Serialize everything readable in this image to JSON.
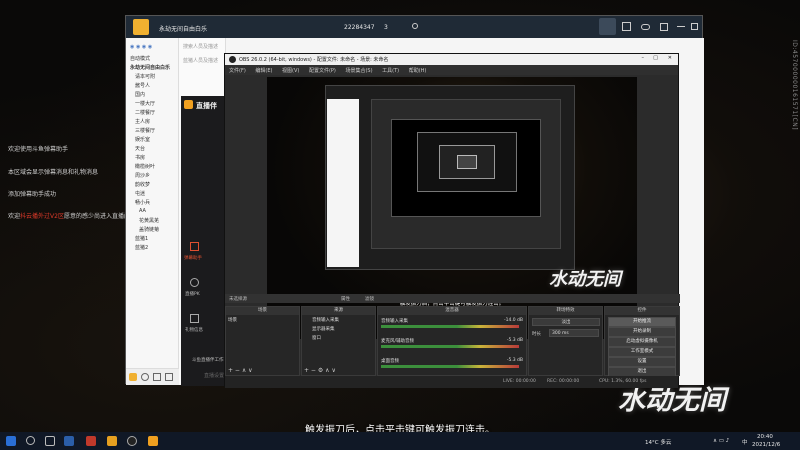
{
  "left_overlay": {
    "lines": [
      "欢迎使用斗鱼弹幕助手",
      "本区域会显示弹幕消息和礼物消息",
      "添加弹幕助手成功"
    ],
    "last_line_prefix": "欢迎",
    "last_line_highlight": "抖云播外过V2区",
    "last_line_suffix": "愿意的感少尚进入直播间"
  },
  "vertical_id": "ID:457000000161571[CN]",
  "watermark_logo": "水动无间",
  "main_subtitle": "触发振刀后，点击平击键可触发振刀连击。",
  "chat_window": {
    "title": "永劫无间自由白乐",
    "id_number": "22284347",
    "member_count": "3",
    "search_hint": "搜索人员及描述",
    "left_items": [
      "自动模式",
      "永劫无间自由白乐",
      "请本可附",
      "酱号人",
      "国内",
      "一楼大厅",
      "二楼餐厅",
      "主人房",
      "三楼餐厅",
      "娱乐室",
      "天台",
      "书房",
      "橄榄树叶",
      "周沙乡",
      "韵收梦",
      "屯迷",
      "畅小兵",
      "AA",
      "花黄黑羌",
      "盖骑链菊",
      "蓝猪1",
      "蓝猪2"
    ],
    "mid_items": [
      "蓝猪人员及描述"
    ],
    "douyu_logo": "直播伴",
    "douyu_menu": [
      "弹幕助手",
      "直播PK",
      "礼物信息"
    ],
    "douyu_footer": "斗鱼直播伴工作台",
    "bottom_label": "直播设置"
  },
  "obs": {
    "title": "OBS 26.0.2 (64-bit, windows) - 配置文件: 未命名 - 场景: 未命名",
    "menu": [
      "文件(F)",
      "编辑(E)",
      "视图(V)",
      "配置文件(P)",
      "场景集合(S)",
      "工具(T)",
      "帮助(H)"
    ],
    "preview_subtitle": "触发振刀后，点击平击键可触发振刀连击。",
    "source_bar_label": "未选择源",
    "source_bar_tabs": [
      "属性",
      "滤镜"
    ],
    "panels": {
      "scenes": {
        "title": "场景",
        "items": [
          "场景"
        ]
      },
      "sources": {
        "title": "来源",
        "items": [
          "音频输入采集",
          "显示器采集",
          "窗口"
        ]
      },
      "mixer": {
        "title": "混音器",
        "channels": [
          {
            "name": "音频输入采集",
            "db": "-14.0 dB"
          },
          {
            "name": "麦克风/辅助音频",
            "db": "-5.3 dB"
          },
          {
            "name": "桌面音频",
            "db": "-5.3 dB"
          }
        ]
      },
      "transitions": {
        "title": "转场特效",
        "type": "淡出",
        "duration_label": "时长",
        "duration_value": "300 ms"
      },
      "controls": {
        "title": "控件",
        "buttons": [
          "开始推流",
          "开始录制",
          "启动虚拟摄像机",
          "工作室模式",
          "设置",
          "退出"
        ]
      }
    },
    "status": {
      "live": "LIVE: 00:00:00",
      "rec": "REC: 00:00:00",
      "cpu": "CPU: 1.3%, 60.00 fps"
    }
  },
  "taskbar": {
    "weather": "14°C 多云",
    "time": "20:40",
    "date": "2021/12/6",
    "lang": "中"
  }
}
